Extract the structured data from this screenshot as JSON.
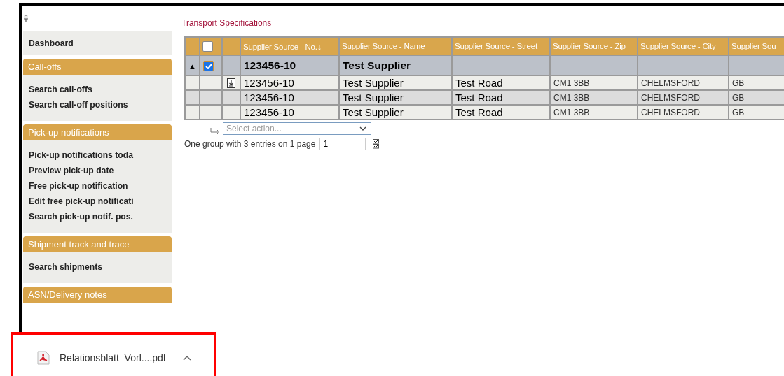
{
  "sidebar": {
    "sections": [
      {
        "kind": "plain",
        "items": [
          "Dashboard"
        ]
      },
      {
        "kind": "group",
        "title": "Call-offs",
        "items": [
          "Search call-offs",
          "Search call-off positions"
        ]
      },
      {
        "kind": "group",
        "title": "Pick-up notifications",
        "items": [
          "Pick-up notifications toda",
          "Preview pick-up date",
          "Free pick-up notification",
          "Edit free pick-up notificati",
          "Search pick-up notif. pos."
        ]
      },
      {
        "kind": "group",
        "title": "Shipment track and trace",
        "items": [
          "Search shipments"
        ]
      },
      {
        "kind": "group",
        "title": "ASN/Delivery notes"
      }
    ]
  },
  "page_title": "Transport Specifications",
  "table": {
    "all_checked": false,
    "columns": [
      {
        "label": "Supplier Source - No.",
        "sort": "↓"
      },
      {
        "label": "Supplier Source - Name"
      },
      {
        "label": "Supplier Source - Street"
      },
      {
        "label": "Supplier Source - Zip"
      },
      {
        "label": "Supplier Source - City"
      },
      {
        "label": "Supplier Sou"
      }
    ],
    "group": {
      "toggle": "▲",
      "expanded": true,
      "checked": true,
      "number": "123456-10",
      "name": "Test Supplier"
    },
    "rows": [
      {
        "attachment": true,
        "cells": [
          "123456-10",
          "Test Supplier",
          "Test Road",
          "CM1 3BB",
          "CHELMSFORD",
          "GB"
        ]
      },
      {
        "attachment": false,
        "cells": [
          "123456-10",
          "Test Supplier",
          "Test Road",
          "CM1 3BB",
          "CHELMSFORD",
          "GB"
        ]
      },
      {
        "attachment": false,
        "cells": [
          "123456-10",
          "Test Supplier",
          "Test Road",
          "CM1 3BB",
          "CHELMSFORD",
          "GB"
        ]
      }
    ],
    "action_select": {
      "placeholder": "Select action..."
    },
    "pager": {
      "summary": "One group with 3 entries on 1 page",
      "page": "1"
    }
  },
  "download": {
    "file": "Relationsblatt_Vorl....pdf"
  }
}
